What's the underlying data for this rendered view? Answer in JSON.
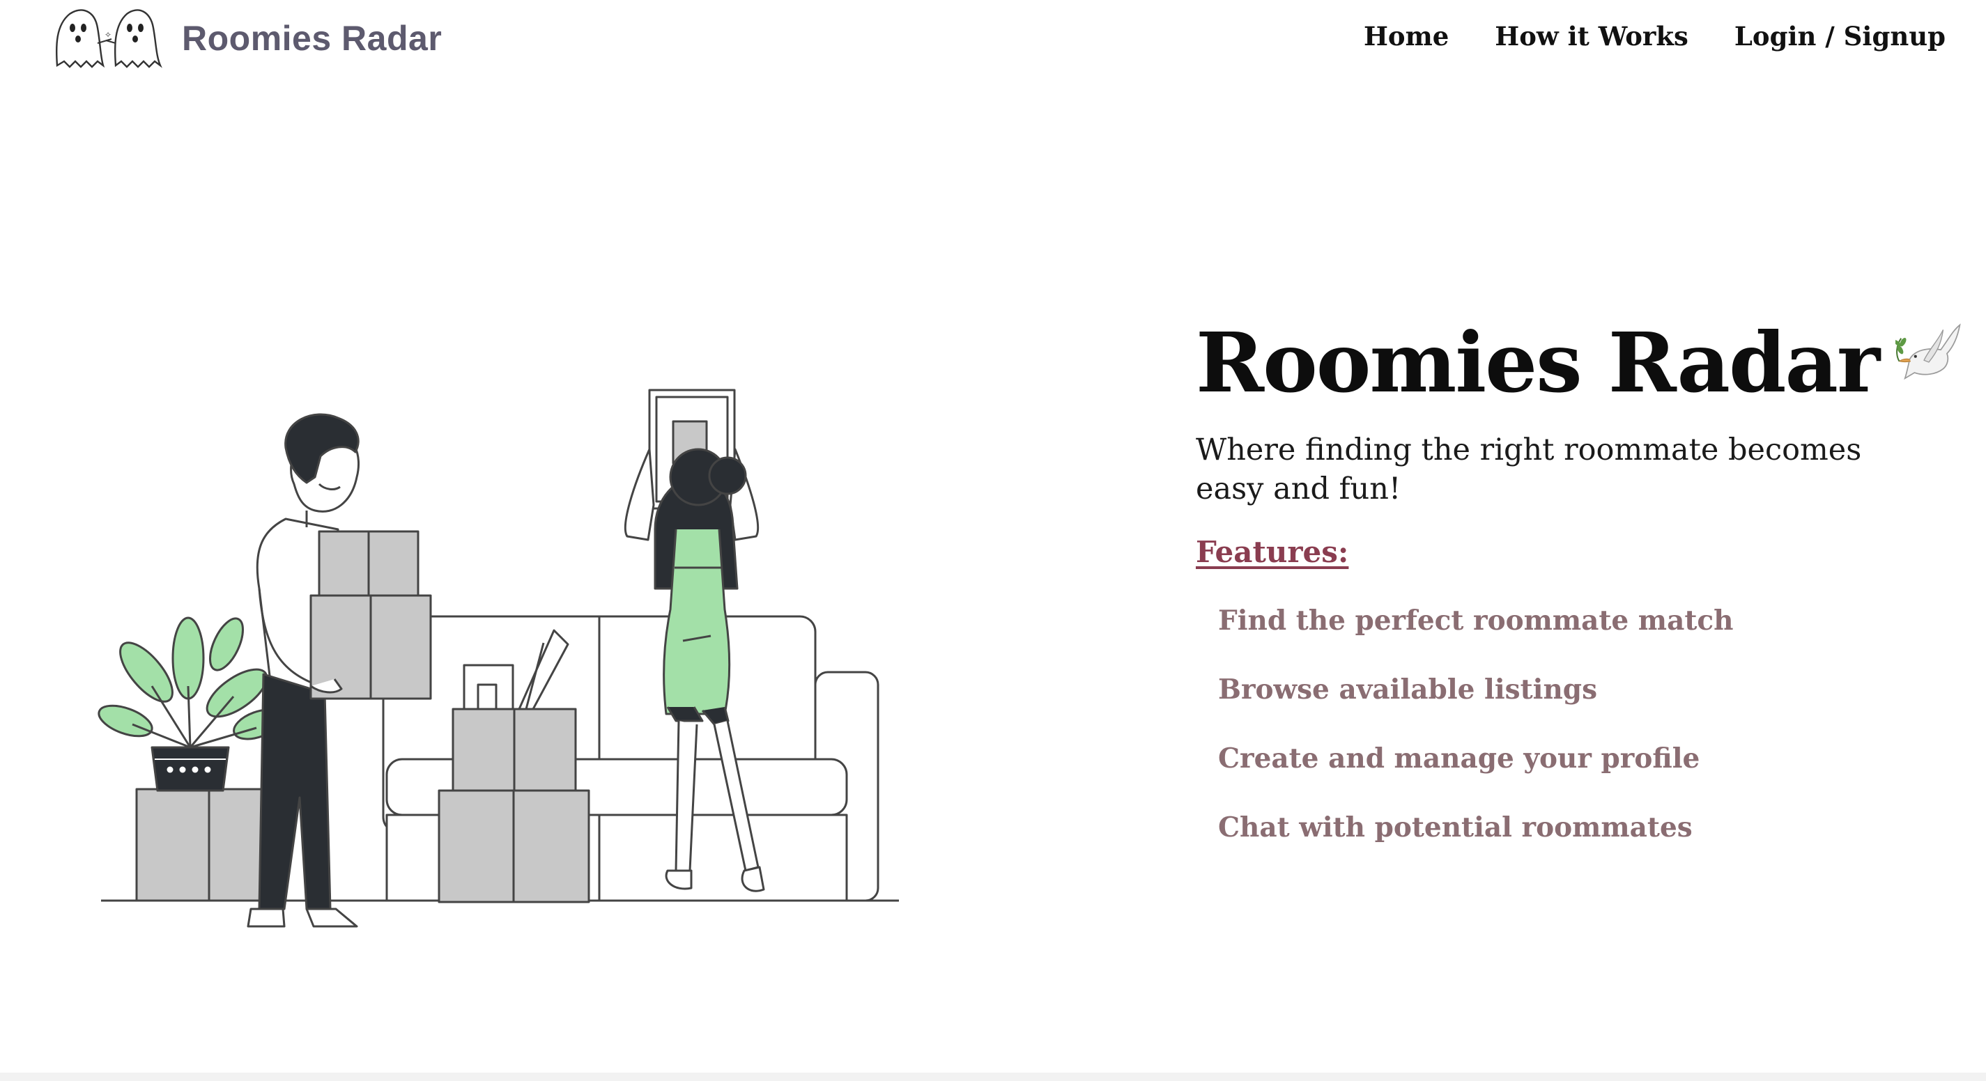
{
  "header": {
    "brand_name": "Roomies Radar",
    "logo_icon": "ghost-pair-icon",
    "nav": [
      {
        "label": "Home"
      },
      {
        "label": "How it Works"
      },
      {
        "label": "Login / Signup"
      }
    ]
  },
  "hero": {
    "title": "Roomies Radar",
    "title_icon": "dove-icon",
    "subtitle": "Where finding the right roommate becomes easy and fun!",
    "features_heading": "Features:",
    "features": [
      "Find the perfect roommate match",
      "Browse available listings",
      "Create and manage your profile",
      "Chat with potential roommates"
    ]
  },
  "colors": {
    "brand": "#5d5a6e",
    "features_heading": "#8a3d50",
    "feature_item": "#8a6d72",
    "accent_green": "#a3e0a8",
    "box_gray": "#c8c8c8",
    "dark": "#2a2e33"
  }
}
